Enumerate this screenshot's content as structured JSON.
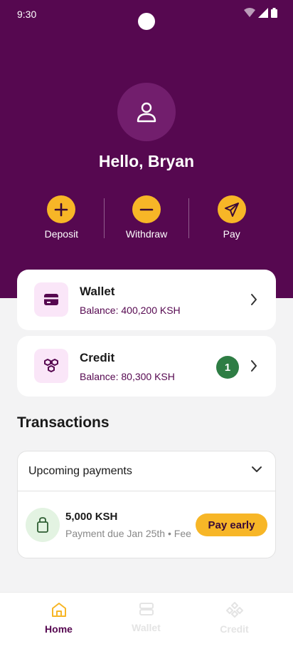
{
  "status_bar": {
    "time": "9:30"
  },
  "profile": {
    "greeting": "Hello, Bryan"
  },
  "actions": [
    {
      "label": "Deposit",
      "icon": "plus-icon"
    },
    {
      "label": "Withdraw",
      "icon": "minus-icon"
    },
    {
      "label": "Pay",
      "icon": "send-icon"
    }
  ],
  "wallet_card": {
    "title": "Wallet",
    "balance": "Balance: 400,200 KSH",
    "icon": "wallet-icon"
  },
  "credit_card": {
    "title": "Credit",
    "balance": "Balance: 80,300 KSH",
    "badge": "1",
    "icon": "credit-icon"
  },
  "transactions": {
    "title": "Transactions",
    "filter_label": "Upcoming payments",
    "items": [
      {
        "amount": "5,000 KSH",
        "due": "Payment due Jan 25th • Fee",
        "action_label": "Pay early",
        "icon": "bag-icon"
      }
    ]
  },
  "bottom_nav": {
    "items": [
      {
        "label": "Home",
        "icon": "home-icon",
        "active": true
      },
      {
        "label": "Wallet",
        "icon": "wallet-nav-icon",
        "active": false
      },
      {
        "label": "Credit",
        "icon": "credit-nav-icon",
        "active": false
      }
    ]
  },
  "colors": {
    "brand_purple": "#560850",
    "accent_yellow": "#f7b627",
    "badge_green": "#2e7d44",
    "background": "#f3f3f4"
  }
}
